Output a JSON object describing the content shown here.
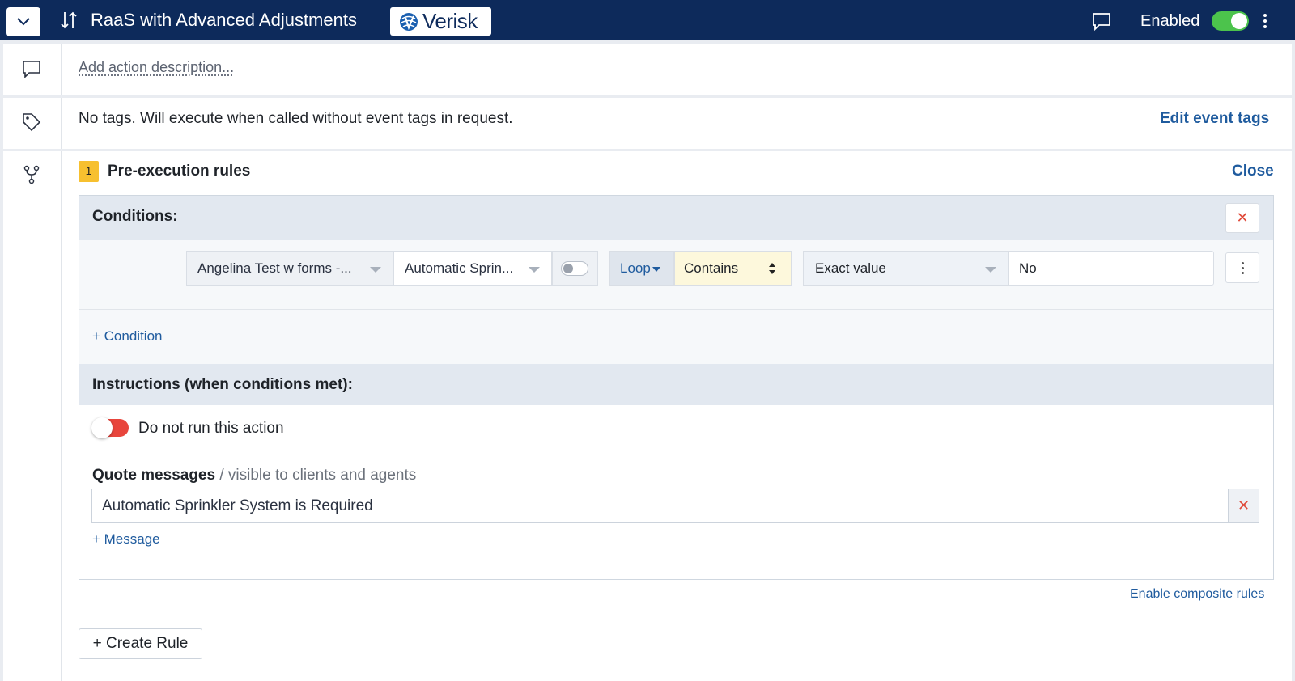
{
  "header": {
    "title": "RaaS with Advanced Adjustments",
    "logo_text": "Verisk",
    "enabled_label": "Enabled",
    "enabled": true,
    "colors": {
      "bar": "#0d2a5b",
      "toggle_on": "#4cc34c"
    }
  },
  "description": {
    "placeholder": "Add action description..."
  },
  "tags": {
    "text": "No tags. Will execute when called without event tags in request.",
    "edit_label": "Edit event tags"
  },
  "rules": {
    "badge": "1",
    "title": "Pre-execution rules",
    "close_label": "Close",
    "conditions_title": "Conditions:",
    "condition": {
      "form_select": "Angelina Test w forms -...",
      "field_select": "Automatic Sprin...",
      "toggle_on": false,
      "loop_label": "Loop",
      "operator": "Contains",
      "value_type": "Exact value",
      "value": "No"
    },
    "add_condition_label": "+ Condition",
    "instructions_title": "Instructions (when conditions met):",
    "do_not_run_label": "Do not run this action",
    "do_not_run_on": false,
    "quote_messages_label": "Quote messages",
    "quote_messages_sub": " / visible to clients and agents",
    "messages": [
      "Automatic Sprinkler System is Required"
    ],
    "add_message_label": "+ Message",
    "composite_label": "Enable composite rules",
    "create_rule_label": "+ Create Rule"
  }
}
